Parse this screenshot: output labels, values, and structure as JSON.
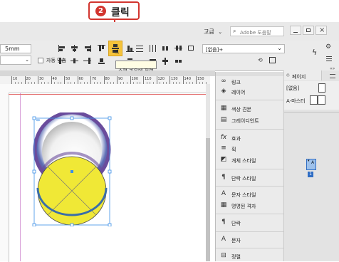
{
  "callout": {
    "step_number": "2",
    "label": "클릭"
  },
  "topbar": {
    "workspace_label": "고급",
    "search_placeholder": "Adobe 도움말",
    "window_buttons": [
      "minimize",
      "restore",
      "close"
    ]
  },
  "control": {
    "size_value": "5mm",
    "auto_fit_label": "자동 맞춤",
    "style_dropdown_value": "[없음]+",
    "tooltip": "수평 가운데 정렬"
  },
  "ruler": {
    "ticks": [
      "10",
      "20",
      "30",
      "40",
      "50",
      "60",
      "70",
      "80",
      "90",
      "100",
      "110",
      "120",
      "130",
      "140",
      "150"
    ]
  },
  "side_panel": {
    "items": [
      {
        "icon": "link-icon",
        "label": "링크"
      },
      {
        "icon": "layers-icon",
        "label": "레이어"
      },
      {
        "icon": "swatches-icon",
        "label": "색상 견본"
      },
      {
        "icon": "gradient-icon",
        "label": "그레이디언트"
      },
      {
        "icon": "effects-icon",
        "label": "효과"
      },
      {
        "icon": "stroke-icon",
        "label": "획"
      },
      {
        "icon": "object-styles-icon",
        "label": "개체 스타일"
      },
      {
        "icon": "paragraph-styles-icon",
        "label": "단락 스타일"
      },
      {
        "icon": "character-styles-icon",
        "label": "문자 스타일"
      },
      {
        "icon": "named-grids-icon",
        "label": "명명된 격자"
      },
      {
        "icon": "paragraph-icon",
        "label": "단락"
      },
      {
        "icon": "character-icon",
        "label": "문자"
      },
      {
        "icon": "align-icon",
        "label": "정렬"
      }
    ]
  },
  "pages_panel": {
    "tab_label": "페이지",
    "none_label": "[없음]",
    "master_label": "A-마스터",
    "page_master_letter": "A",
    "page_number": "1"
  },
  "colors": {
    "callout_red": "#d2352f",
    "highlight": "#f5c33b",
    "circle_fill": "#f0e836",
    "ring": "#6a4c9c",
    "selection": "#3b8ee6"
  }
}
